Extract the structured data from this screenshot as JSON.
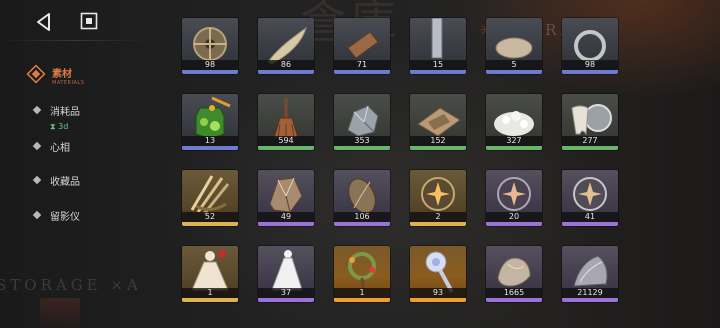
{
  "header": {
    "watermark_text": "倉庫",
    "storage_label": "STORAGE",
    "storage_bottom_label": "STORAGE ×A"
  },
  "nav": {
    "active": {
      "label": "素材",
      "sublabel": "MATERIALS"
    },
    "items": [
      {
        "label": "消耗品",
        "timer": "⧗ 3d"
      },
      {
        "label": "心相"
      },
      {
        "label": "收藏品"
      },
      {
        "label": "留影仪"
      }
    ]
  },
  "colors": {
    "accent": "#e07a45",
    "timer": "#5fd07a",
    "quality_blue": "#6f7bd0",
    "quality_green": "#6ab56b",
    "quality_purple": "#9a72d8",
    "quality_gold": "#e0b24e",
    "quality_orange": "#f0a030"
  },
  "inventory": {
    "rows": [
      {
        "items": [
          {
            "name": "gear-item",
            "count": "98",
            "quality": "blue"
          },
          {
            "name": "feather-item",
            "count": "86",
            "quality": "blue"
          },
          {
            "name": "wood-item",
            "count": "71",
            "quality": "blue"
          },
          {
            "name": "blade-item",
            "count": "15",
            "quality": "blue"
          },
          {
            "name": "clay-item",
            "count": "5",
            "quality": "blue"
          },
          {
            "name": "ring-item",
            "count": "98",
            "quality": "blue"
          }
        ]
      },
      {
        "items": [
          {
            "name": "honey-jar-item",
            "count": "13",
            "quality": "blue"
          },
          {
            "name": "broom-item",
            "count": "594",
            "quality": "green"
          },
          {
            "name": "ore-item",
            "count": "353",
            "quality": "green"
          },
          {
            "name": "cloth-scraps-item",
            "count": "152",
            "quality": "green"
          },
          {
            "name": "salt-crystal-item",
            "count": "327",
            "quality": "green"
          },
          {
            "name": "tooth-lens-item",
            "count": "277",
            "quality": "green"
          }
        ]
      },
      {
        "items": [
          {
            "name": "bundle-sticks-item",
            "count": "52",
            "quality": "gold"
          },
          {
            "name": "crystal-rock-item",
            "count": "49",
            "quality": "purple"
          },
          {
            "name": "seed-shell-item",
            "count": "106",
            "quality": "purple"
          },
          {
            "name": "golden-orb-item",
            "count": "2",
            "quality": "gold"
          },
          {
            "name": "rose-orb-item",
            "count": "20",
            "quality": "purple"
          },
          {
            "name": "silver-orb-item",
            "count": "41",
            "quality": "purple"
          }
        ]
      },
      {
        "items": [
          {
            "name": "dress-doll-item",
            "count": "1",
            "quality": "gold"
          },
          {
            "name": "gown-item",
            "count": "37",
            "quality": "purple"
          },
          {
            "name": "wreath-staff-item",
            "count": "1",
            "quality": "orange"
          },
          {
            "name": "scepter-item",
            "count": "93",
            "quality": "orange"
          },
          {
            "name": "clay-shell-item",
            "count": "1665",
            "quality": "purple"
          },
          {
            "name": "silver-shard-item",
            "count": "21129",
            "quality": "purple"
          }
        ]
      }
    ]
  }
}
